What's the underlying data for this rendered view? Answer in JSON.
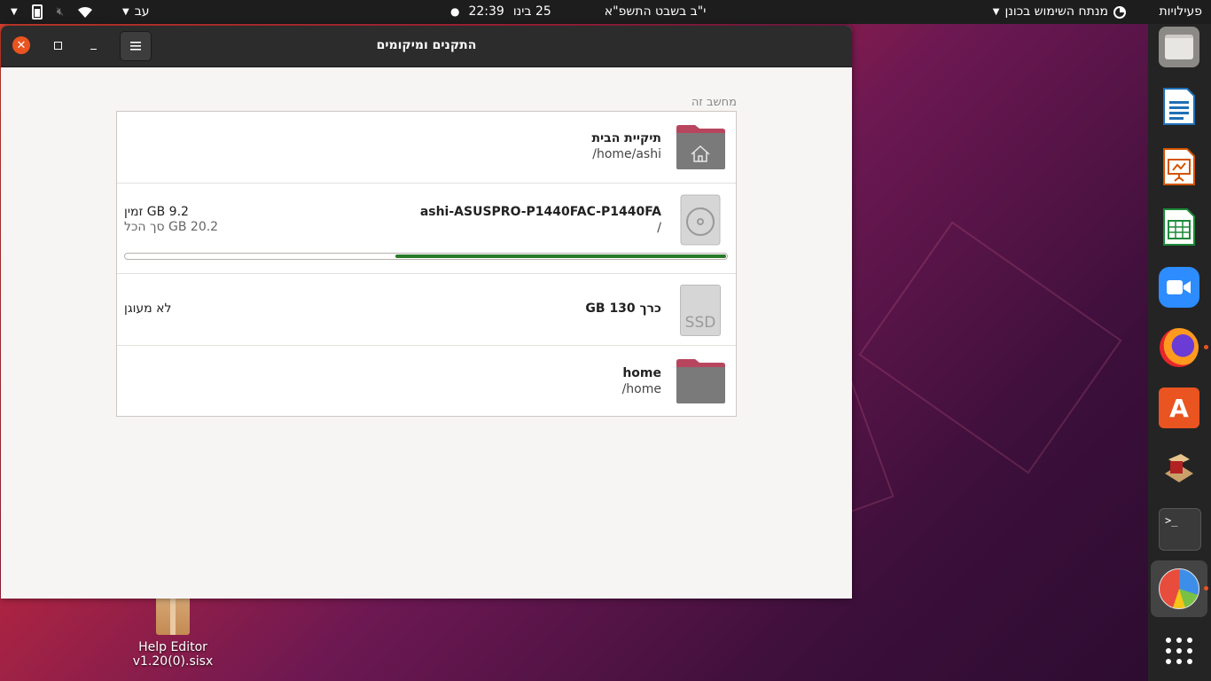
{
  "topbar": {
    "activities": "פעילויות",
    "app_menu": "מנתח השימוש בכונן",
    "hebrew_date": "י\"ב בשבט התשפ\"א",
    "date": "25 בינו",
    "time": "22:39",
    "keyboard_layout": "עב"
  },
  "window": {
    "title": "התקנים ומיקומים",
    "section_label": "מחשב זה",
    "rows": [
      {
        "title": "תיקיית הבית",
        "subtitle": "/home/ashi"
      },
      {
        "title": "ashi-ASUSPRO-P1440FAC-P1440FA",
        "subtitle": "/",
        "free": "9.2 GB זמין",
        "total": "20.2 GB סך הכל",
        "usage_fraction": 0.55
      },
      {
        "title": "כרך 130 GB",
        "status": "לא מעוגן",
        "icon_text": "SSD"
      },
      {
        "title": "home",
        "subtitle": "/home"
      }
    ]
  },
  "desktop": {
    "file_label_line1": "Help Editor",
    "file_label_line2": "v1.20(0).sisx"
  },
  "colors": {
    "accent": "#e95420",
    "progress": "#2a7a2a",
    "folder": "#7a7a7a",
    "folder_tab": "#b8455e"
  }
}
